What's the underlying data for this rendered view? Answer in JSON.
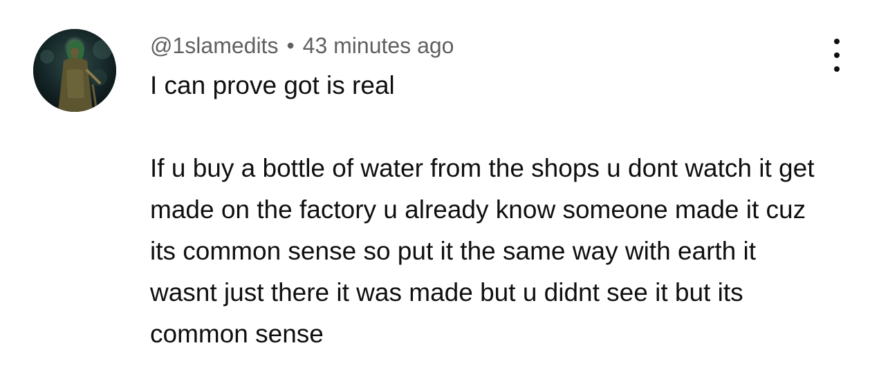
{
  "comment": {
    "author": "@1slamedits",
    "separator": "•",
    "timestamp": "43 minutes ago",
    "text_line1": "I can prove got is real",
    "text_body": "If u buy a bottle of water from the shops u dont watch it get made on the factory u already know someone made it cuz its common sense so put it the same way with earth it wasnt just there it was made but u didnt see it but its common sense",
    "menu_icon": "more-vertical-icon"
  }
}
